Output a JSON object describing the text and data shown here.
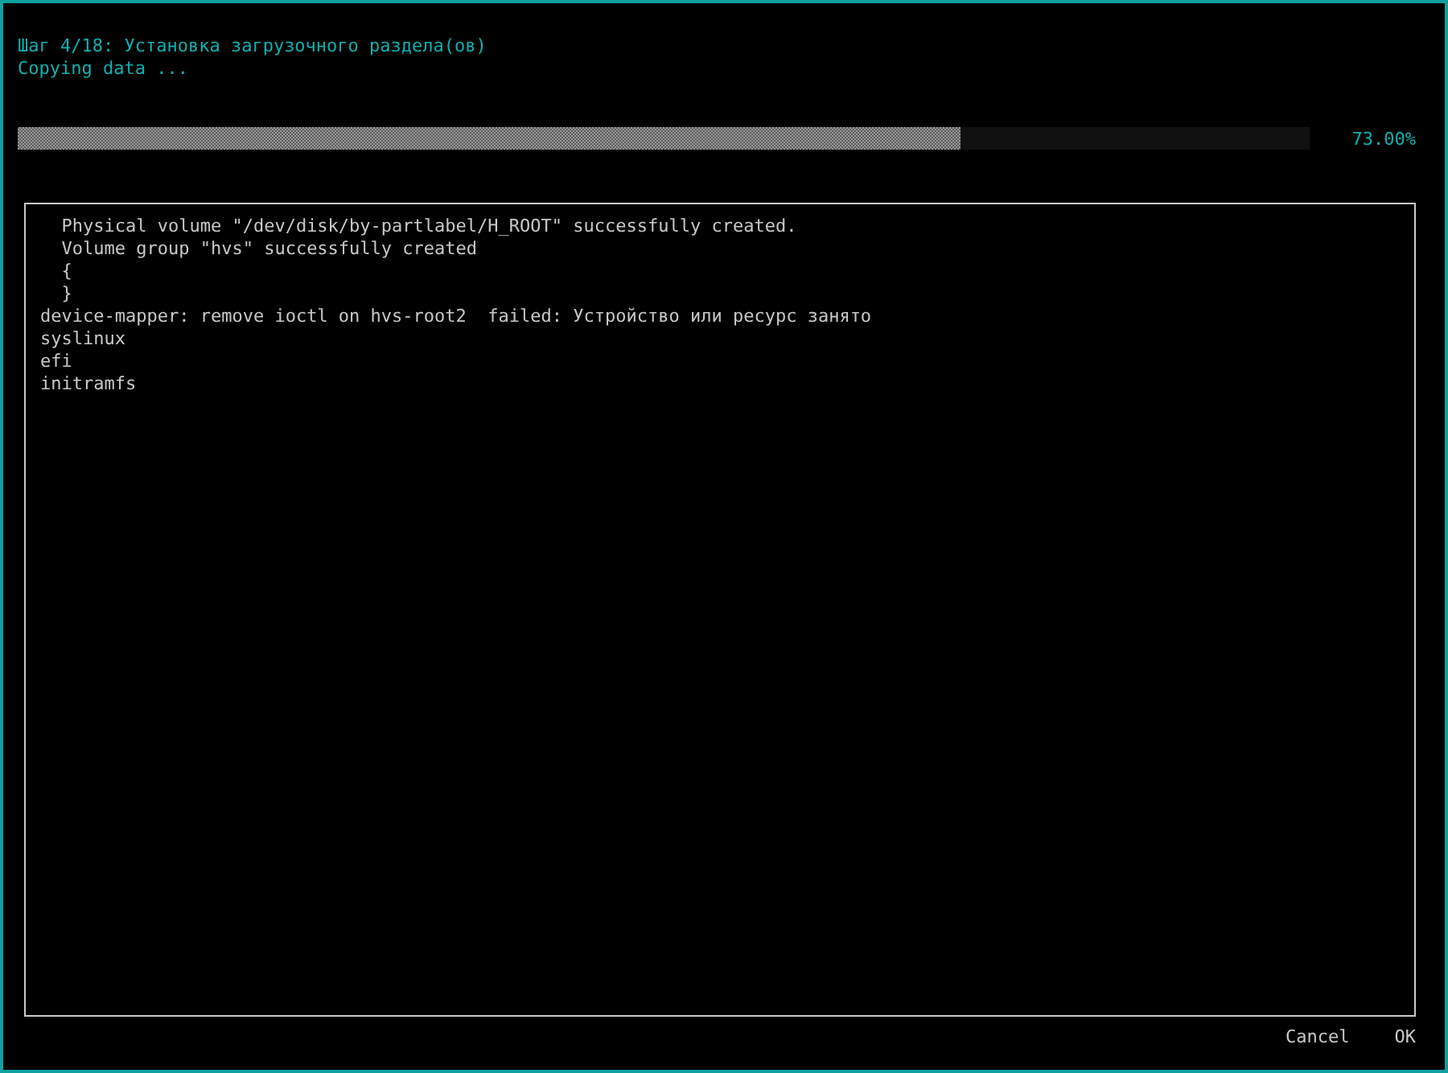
{
  "header": {
    "step": "Шаг 4/18: Установка загрузочного раздела(ов)",
    "status": "Copying data ..."
  },
  "progress": {
    "level": 0.73,
    "reading": "73.00%"
  },
  "log": [
    "  Physical volume \"/dev/disk/by-partlabel/H_ROOT\" successfully created.",
    "  Volume group \"hvs\" successfully created",
    "  {",
    "  }",
    "device-mapper: remove ioctl on hvs-root2  failed: Устройство или ресурс занято",
    "syslinux",
    "efi",
    "initramfs"
  ],
  "buttons": [
    "Cancel",
    "OK"
  ]
}
